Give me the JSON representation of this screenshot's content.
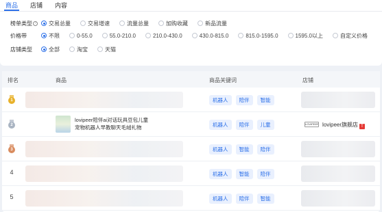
{
  "tabs": [
    {
      "label": "商品"
    },
    {
      "label": "店铺"
    },
    {
      "label": "内容"
    }
  ],
  "filters": {
    "ranking_type": {
      "label": "榜单类型",
      "options": [
        "交易总量",
        "交易增速",
        "流量总量",
        "加购收藏",
        "新品流量"
      ],
      "selected": "交易总量"
    },
    "price_band": {
      "label": "价格带",
      "options": [
        "不限",
        "0-55.0",
        "55.0-210.0",
        "210.0-430.0",
        "430.0-815.0",
        "815.0-1595.0",
        "1595.0以上",
        "自定义价格"
      ],
      "selected": "不限"
    },
    "shop_type": {
      "label": "店铺类型",
      "options": [
        "全部",
        "淘宝",
        "天猫"
      ],
      "selected": "全部"
    }
  },
  "table": {
    "headers": [
      "排名",
      "商品",
      "商品关键词",
      "店铺"
    ],
    "rows": [
      {
        "rank": "",
        "medal": "gold",
        "title": "",
        "keywords": [
          "机器人",
          "陪伴",
          "智能"
        ],
        "shop": "",
        "tmall": false
      },
      {
        "rank": "",
        "medal": "silver",
        "title": "lovipeer陪伴ai对话玩具豆包儿童宠物机器人早教聊天毛绒礼物",
        "keywords": [
          "机器人",
          "陪伴",
          "儿童"
        ],
        "shop": "lovipeer旗舰店",
        "shop_logo": "LOVIPEER",
        "tmall": true,
        "tmall_badge": "T"
      },
      {
        "rank": "",
        "medal": "bronze",
        "title": "",
        "keywords": [
          "机器人",
          "智能",
          "陪伴"
        ],
        "shop": "",
        "tmall": false
      },
      {
        "rank": "4",
        "medal": "",
        "title": "",
        "keywords": [
          "机器人",
          "智能",
          "陪伴"
        ],
        "shop": "",
        "tmall": false
      },
      {
        "rank": "5",
        "medal": "",
        "title": "",
        "keywords": [
          "机器人",
          "陪伴",
          "智能"
        ],
        "shop": "",
        "tmall": false
      }
    ]
  },
  "medal_labels": {
    "gold": "1",
    "silver": "2",
    "bronze": "3"
  },
  "colors": {
    "accent": "#2b6fe8",
    "gold": "#e8b12a",
    "silver": "#a9b4c2",
    "bronze": "#d98c5f",
    "tmall": "#e53935"
  }
}
